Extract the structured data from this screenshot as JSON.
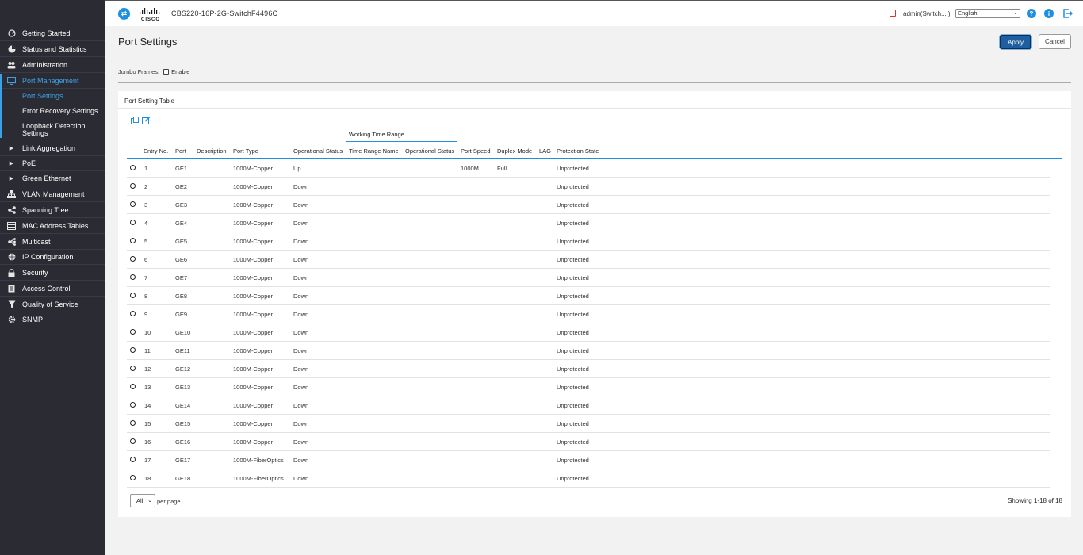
{
  "sidebar": {
    "items": [
      {
        "label": "Getting Started",
        "icon": "speedometer-icon"
      },
      {
        "label": "Status and Statistics",
        "icon": "pie-chart-icon"
      },
      {
        "label": "Administration",
        "icon": "users-icon"
      },
      {
        "label": "Port Management",
        "icon": "monitor-icon",
        "active": true
      },
      {
        "label": "Link Aggregation",
        "icon": "chevron-right-icon"
      },
      {
        "label": "PoE",
        "icon": "chevron-right-icon"
      },
      {
        "label": "Green Ethernet",
        "icon": "chevron-right-icon"
      },
      {
        "label": "VLAN Management",
        "icon": "sitemap-icon"
      },
      {
        "label": "Spanning Tree",
        "icon": "share-icon"
      },
      {
        "label": "MAC Address Tables",
        "icon": "table-icon"
      },
      {
        "label": "Multicast",
        "icon": "multicast-icon"
      },
      {
        "label": "IP Configuration",
        "icon": "globe-icon"
      },
      {
        "label": "Security",
        "icon": "lock-icon"
      },
      {
        "label": "Access Control",
        "icon": "list-icon"
      },
      {
        "label": "Quality of Service",
        "icon": "filter-icon"
      },
      {
        "label": "SNMP",
        "icon": "gear-icon"
      }
    ],
    "subitems": [
      {
        "label": "Port Settings",
        "active": true
      },
      {
        "label": "Error Recovery Settings"
      },
      {
        "label": "Loopback Detection"
      },
      {
        "label": "Settings"
      }
    ]
  },
  "header": {
    "device_name": "CBS220-16P-2G-SwitchF4496C",
    "user": "admin(Switch... )",
    "language": "English",
    "help_glyph": "?",
    "info_glyph": "i",
    "accent_color": "#1f8fe0"
  },
  "page": {
    "title": "Port Settings",
    "apply_label": "Apply",
    "cancel_label": "Cancel",
    "jumbo_label": "Jumbo Frames:",
    "jumbo_enable_label": "Enable"
  },
  "table": {
    "title": "Port Setting Table",
    "group_header": "Working Time Range",
    "columns": [
      "Entry No.",
      "Port",
      "Description",
      "Port Type",
      "Operational Status",
      "Time Range Name",
      "Operational Status",
      "Port Speed",
      "Duplex Mode",
      "LAG",
      "Protection State"
    ],
    "rows": [
      {
        "entry": "1",
        "port": "GE1",
        "description": "",
        "type": "1000M-Copper",
        "status": "Up",
        "trname": "",
        "trstatus": "",
        "speed": "1000M",
        "duplex": "Full",
        "lag": "",
        "protection": "Unprotected"
      },
      {
        "entry": "2",
        "port": "GE2",
        "description": "",
        "type": "1000M-Copper",
        "status": "Down",
        "trname": "",
        "trstatus": "",
        "speed": "",
        "duplex": "",
        "lag": "",
        "protection": "Unprotected"
      },
      {
        "entry": "3",
        "port": "GE3",
        "description": "",
        "type": "1000M-Copper",
        "status": "Down",
        "trname": "",
        "trstatus": "",
        "speed": "",
        "duplex": "",
        "lag": "",
        "protection": "Unprotected"
      },
      {
        "entry": "4",
        "port": "GE4",
        "description": "",
        "type": "1000M-Copper",
        "status": "Down",
        "trname": "",
        "trstatus": "",
        "speed": "",
        "duplex": "",
        "lag": "",
        "protection": "Unprotected"
      },
      {
        "entry": "5",
        "port": "GE5",
        "description": "",
        "type": "1000M-Copper",
        "status": "Down",
        "trname": "",
        "trstatus": "",
        "speed": "",
        "duplex": "",
        "lag": "",
        "protection": "Unprotected"
      },
      {
        "entry": "6",
        "port": "GE6",
        "description": "",
        "type": "1000M-Copper",
        "status": "Down",
        "trname": "",
        "trstatus": "",
        "speed": "",
        "duplex": "",
        "lag": "",
        "protection": "Unprotected"
      },
      {
        "entry": "7",
        "port": "GE7",
        "description": "",
        "type": "1000M-Copper",
        "status": "Down",
        "trname": "",
        "trstatus": "",
        "speed": "",
        "duplex": "",
        "lag": "",
        "protection": "Unprotected"
      },
      {
        "entry": "8",
        "port": "GE8",
        "description": "",
        "type": "1000M-Copper",
        "status": "Down",
        "trname": "",
        "trstatus": "",
        "speed": "",
        "duplex": "",
        "lag": "",
        "protection": "Unprotected"
      },
      {
        "entry": "9",
        "port": "GE9",
        "description": "",
        "type": "1000M-Copper",
        "status": "Down",
        "trname": "",
        "trstatus": "",
        "speed": "",
        "duplex": "",
        "lag": "",
        "protection": "Unprotected"
      },
      {
        "entry": "10",
        "port": "GE10",
        "description": "",
        "type": "1000M-Copper",
        "status": "Down",
        "trname": "",
        "trstatus": "",
        "speed": "",
        "duplex": "",
        "lag": "",
        "protection": "Unprotected"
      },
      {
        "entry": "11",
        "port": "GE11",
        "description": "",
        "type": "1000M-Copper",
        "status": "Down",
        "trname": "",
        "trstatus": "",
        "speed": "",
        "duplex": "",
        "lag": "",
        "protection": "Unprotected"
      },
      {
        "entry": "12",
        "port": "GE12",
        "description": "",
        "type": "1000M-Copper",
        "status": "Down",
        "trname": "",
        "trstatus": "",
        "speed": "",
        "duplex": "",
        "lag": "",
        "protection": "Unprotected"
      },
      {
        "entry": "13",
        "port": "GE13",
        "description": "",
        "type": "1000M-Copper",
        "status": "Down",
        "trname": "",
        "trstatus": "",
        "speed": "",
        "duplex": "",
        "lag": "",
        "protection": "Unprotected"
      },
      {
        "entry": "14",
        "port": "GE14",
        "description": "",
        "type": "1000M-Copper",
        "status": "Down",
        "trname": "",
        "trstatus": "",
        "speed": "",
        "duplex": "",
        "lag": "",
        "protection": "Unprotected"
      },
      {
        "entry": "15",
        "port": "GE15",
        "description": "",
        "type": "1000M-Copper",
        "status": "Down",
        "trname": "",
        "trstatus": "",
        "speed": "",
        "duplex": "",
        "lag": "",
        "protection": "Unprotected"
      },
      {
        "entry": "16",
        "port": "GE16",
        "description": "",
        "type": "1000M-Copper",
        "status": "Down",
        "trname": "",
        "trstatus": "",
        "speed": "",
        "duplex": "",
        "lag": "",
        "protection": "Unprotected"
      },
      {
        "entry": "17",
        "port": "GE17",
        "description": "",
        "type": "1000M-FiberOptics",
        "status": "Down",
        "trname": "",
        "trstatus": "",
        "speed": "",
        "duplex": "",
        "lag": "",
        "protection": "Unprotected"
      },
      {
        "entry": "18",
        "port": "GE18",
        "description": "",
        "type": "1000M-FiberOptics",
        "status": "Down",
        "trname": "",
        "trstatus": "",
        "speed": "",
        "duplex": "",
        "lag": "",
        "protection": "Unprotected"
      }
    ],
    "per_page_value": "All",
    "per_page_label": "per page",
    "showing_text": "Showing 1-18 of 18"
  }
}
